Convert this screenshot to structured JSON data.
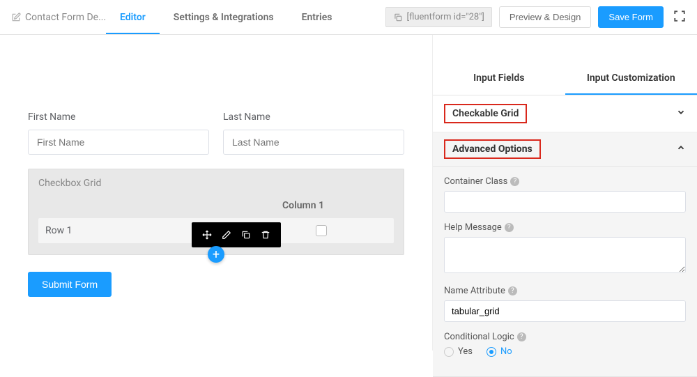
{
  "header": {
    "form_title": "Contact Form De...",
    "tabs": {
      "editor": "Editor",
      "settings": "Settings & Integrations",
      "entries": "Entries"
    },
    "shortcode": "[fluentform id=\"28\"]",
    "preview_btn": "Preview & Design",
    "save_btn": "Save Form"
  },
  "canvas": {
    "first_name_label": "First Name",
    "first_name_placeholder": "First Name",
    "last_name_label": "Last Name",
    "last_name_placeholder": "Last Name",
    "grid_title": "Checkbox Grid",
    "grid_col1": "Column 1",
    "grid_row1": "Row 1",
    "submit_label": "Submit Form"
  },
  "sidebar": {
    "tab_fields": "Input Fields",
    "tab_custom": "Input Customization",
    "section_checkable": "Checkable Grid",
    "section_advanced": "Advanced Options",
    "container_class_label": "Container Class",
    "container_class_value": "",
    "help_message_label": "Help Message",
    "help_message_value": "",
    "name_attr_label": "Name Attribute",
    "name_attr_value": "tabular_grid",
    "cond_logic_label": "Conditional Logic",
    "cond_yes": "Yes",
    "cond_no": "No"
  }
}
